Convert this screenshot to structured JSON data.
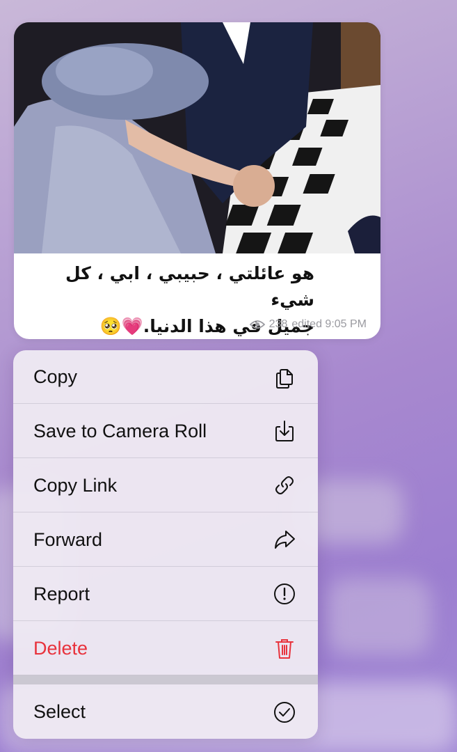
{
  "message": {
    "caption_line1": "هو  عائلتي ، حبيبي ، ابي ، كل شيء",
    "caption_line2": "جميل في هذا الدنيا.💗🥺",
    "views": "238",
    "edited_time": "edited 9:05 PM",
    "image_description": "photo of a couple dancing on a checkered floor"
  },
  "menu": {
    "items": [
      {
        "label": "Copy",
        "icon": "copy-icon"
      },
      {
        "label": "Save to Camera Roll",
        "icon": "save-download-icon"
      },
      {
        "label": "Copy Link",
        "icon": "link-icon"
      },
      {
        "label": "Forward",
        "icon": "forward-arrow-icon"
      },
      {
        "label": "Report",
        "icon": "report-exclamation-icon"
      },
      {
        "label": "Delete",
        "icon": "trash-icon",
        "color": "#e8323c"
      },
      {
        "label": "Select",
        "icon": "checkmark-circle-icon"
      }
    ]
  },
  "colors": {
    "accent_danger": "#e8323c",
    "background": "#a889cf"
  }
}
